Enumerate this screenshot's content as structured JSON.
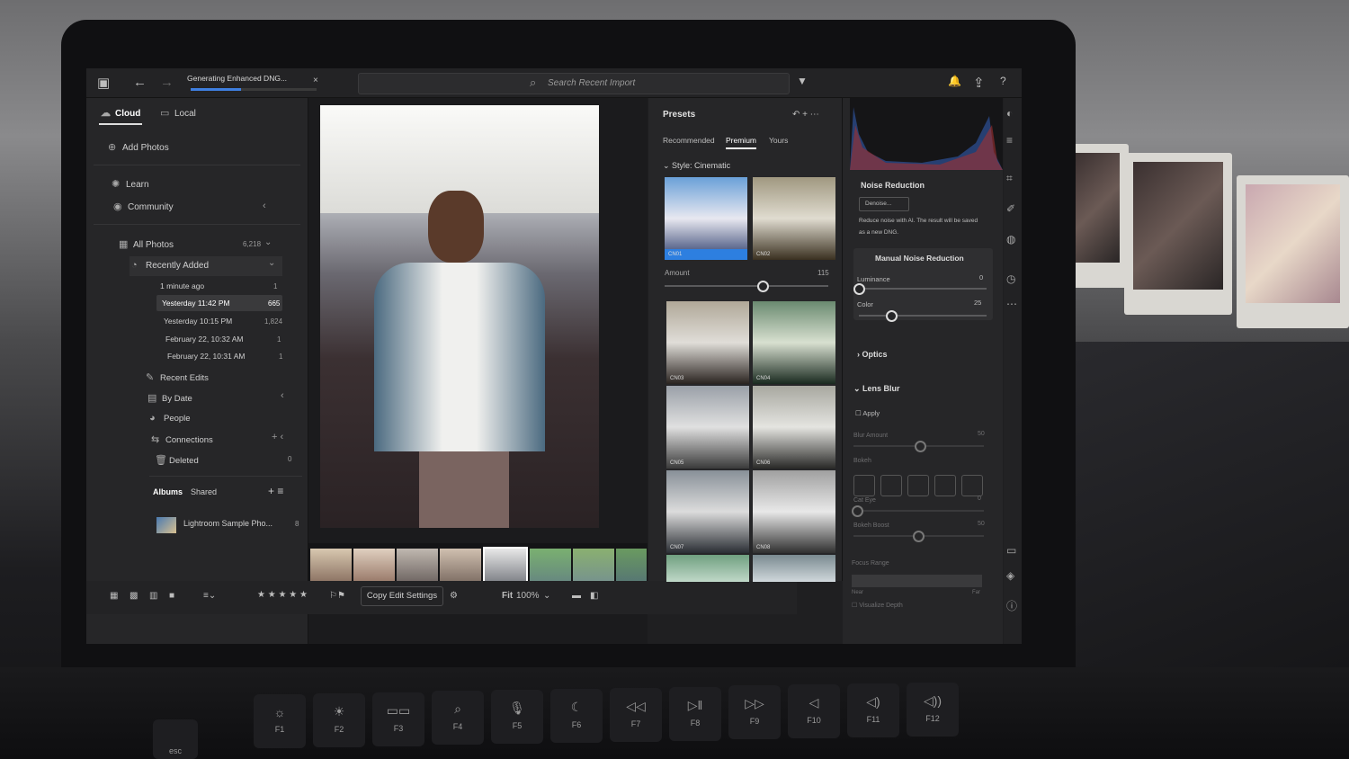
{
  "topbar": {
    "progress_label": "Generating Enhanced DNG...",
    "progress_fraction": 0.4,
    "close_glyph": "×",
    "search_placeholder": "Search Recent Import",
    "icons": [
      "panel-toggle-icon",
      "back-arrow-icon",
      "forward-arrow-icon",
      "search-icon",
      "filter-icon",
      "bell-icon",
      "share-icon",
      "help-icon",
      "cloud-sync-icon"
    ]
  },
  "sidebar": {
    "tab_cloud": "Cloud",
    "tab_local": "Local",
    "add_photos": "Add Photos",
    "learn": "Learn",
    "community": "Community",
    "all_photos": "All Photos",
    "all_photos_count": "6,218",
    "recently_added": "Recently Added",
    "items": [
      {
        "label": "1 minute ago",
        "count": "1"
      },
      {
        "label": "Yesterday 11:42 PM",
        "count": "665"
      },
      {
        "label": "Yesterday 10:15 PM",
        "count": "1,824"
      },
      {
        "label": "February 22, 10:32 AM",
        "count": "1"
      },
      {
        "label": "February 22, 10:31 AM",
        "count": "1"
      }
    ],
    "recent_edits": "Recent Edits",
    "by_date": "By Date",
    "people": "People",
    "connections": "Connections",
    "deleted": "Deleted",
    "deleted_count": "0",
    "albums_tab": "Albums",
    "shared_tab": "Shared",
    "album_name": "Lightroom Sample Pho...",
    "album_count": "8"
  },
  "bottombar": {
    "copy_edit": "Copy Edit Settings",
    "fit_label": "Fit",
    "zoom": "100%",
    "rating_stars": "★ ★ ★ ★ ★"
  },
  "presets": {
    "title": "Presets",
    "tabs": [
      "Recommended",
      "Premium",
      "Yours"
    ],
    "active_tab": "Premium",
    "style": "Style: Cinematic",
    "amount_label": "Amount",
    "amount_value": "115",
    "amount_fraction": 0.6,
    "thumbs": [
      "CN01",
      "CN02",
      "CN03",
      "CN04",
      "CN05",
      "CN06",
      "CN07",
      "CN08",
      "",
      ""
    ]
  },
  "edit": {
    "noise_reduction": "Noise Reduction",
    "denoise_btn": "Denoise...",
    "noise_desc_1": "Reduce noise with AI. The result will be saved",
    "noise_desc_2": "as a new DNG.",
    "manual_nr": "Manual Noise Reduction",
    "luminance": "Luminance",
    "luminance_value": "0",
    "color": "Color",
    "color_value": "25",
    "optics": "Optics",
    "lens_blur": "Lens Blur",
    "apply": "Apply",
    "blur_amount": "Blur Amount",
    "blur_amount_value": "50",
    "bokeh": "Bokeh",
    "cat_eye": "Cat Eye",
    "cat_eye_value": "0",
    "bokeh_boost": "Bokeh Boost",
    "bokeh_boost_value": "50",
    "focus_range": "Focus Range",
    "near": "Near",
    "far": "Far",
    "visualize_depth": "Visualize Depth"
  },
  "keyboard": {
    "keys": [
      {
        "glyph": "☼",
        "label": "F1"
      },
      {
        "glyph": "☀",
        "label": "F2"
      },
      {
        "glyph": "▭▭",
        "label": "F3"
      },
      {
        "glyph": "⌕",
        "label": "F4"
      },
      {
        "glyph": "🎙",
        "label": "F5"
      },
      {
        "glyph": "☾",
        "label": "F6"
      },
      {
        "glyph": "◁◁",
        "label": "F7"
      },
      {
        "glyph": "▷‖",
        "label": "F8"
      },
      {
        "glyph": "▷▷",
        "label": "F9"
      },
      {
        "glyph": "◁",
        "label": "F10"
      },
      {
        "glyph": "◁)",
        "label": "F11"
      },
      {
        "glyph": "◁))",
        "label": "F12"
      }
    ],
    "esc": "esc"
  }
}
